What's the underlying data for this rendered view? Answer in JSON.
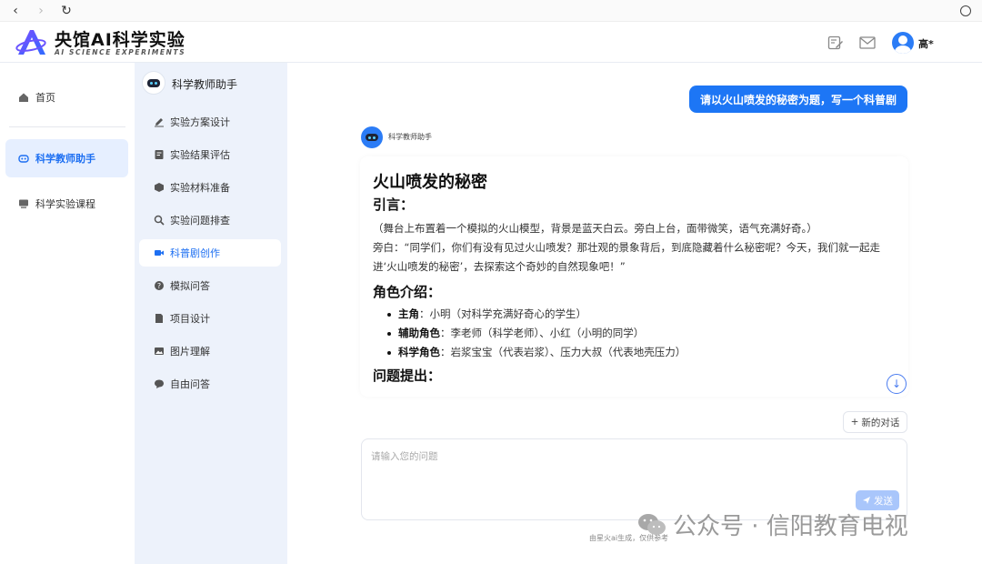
{
  "brand": {
    "title": "央馆AI科学实验",
    "subtitle": "AI SCIENCE EXPERIMENTS",
    "accent": "#1d6ff2"
  },
  "header": {
    "icons": [
      "edit-note-icon",
      "mail-icon",
      "user-avatar"
    ],
    "user_name": "高*"
  },
  "left_nav": {
    "items": [
      {
        "label": "首页",
        "icon": "home-icon",
        "active": false
      },
      {
        "label": "科学教师助手",
        "icon": "robot-icon",
        "active": true
      },
      {
        "label": "科学实验课程",
        "icon": "monitor-icon",
        "active": false
      }
    ]
  },
  "sub_menu": {
    "title": "科学教师助手",
    "items": [
      {
        "label": "实验方案设计",
        "icon": "pencil-icon",
        "active": false
      },
      {
        "label": "实验结果评估",
        "icon": "checklist-icon",
        "active": false
      },
      {
        "label": "实验材料准备",
        "icon": "cube-icon",
        "active": false
      },
      {
        "label": "实验问题排查",
        "icon": "search-icon",
        "active": false
      },
      {
        "label": "科普剧创作",
        "icon": "video-icon",
        "active": true
      },
      {
        "label": "模拟问答",
        "icon": "question-icon",
        "active": false
      },
      {
        "label": "项目设计",
        "icon": "document-icon",
        "active": false
      },
      {
        "label": "图片理解",
        "icon": "image-icon",
        "active": false
      },
      {
        "label": "自由问答",
        "icon": "chat-icon",
        "active": false
      }
    ]
  },
  "chat": {
    "user_message": "请以火山喷发的秘密为题，写一个科普剧",
    "bot_name": "科学教师助手",
    "answer": {
      "title": "火山喷发的秘密",
      "intro_heading": "引言：",
      "intro_stage": "（舞台上布置着一个模拟的火山模型，背景是蓝天白云。旁白上台，面带微笑，语气充满好奇。）",
      "intro_narration": "旁白：“同学们，你们有没有见过火山喷发？那壮观的景象背后，到底隐藏着什么秘密呢？今天，我们就一起走进‘火山喷发的秘密’，去探索这个奇妙的自然现象吧！”",
      "roles_heading": "角色介绍：",
      "roles": [
        {
          "label": "主角",
          "text": "：小明（对科学充满好奇心的学生）"
        },
        {
          "label": "辅助角色",
          "text": "：李老师（科学老师）、小红（小明的同学）"
        },
        {
          "label": "科学角色",
          "text": "：岩浆宝宝（代表岩浆）、压力大叔（代表地壳压力）"
        }
      ],
      "question_heading": "问题提出："
    },
    "new_chat_label": "新的对话",
    "input_placeholder": "请输入您的问题",
    "send_label": "发送",
    "footer_note": "由星火ai生成，仅供参考"
  },
  "watermark": {
    "text": "公众号 · 信阳教育电视"
  }
}
